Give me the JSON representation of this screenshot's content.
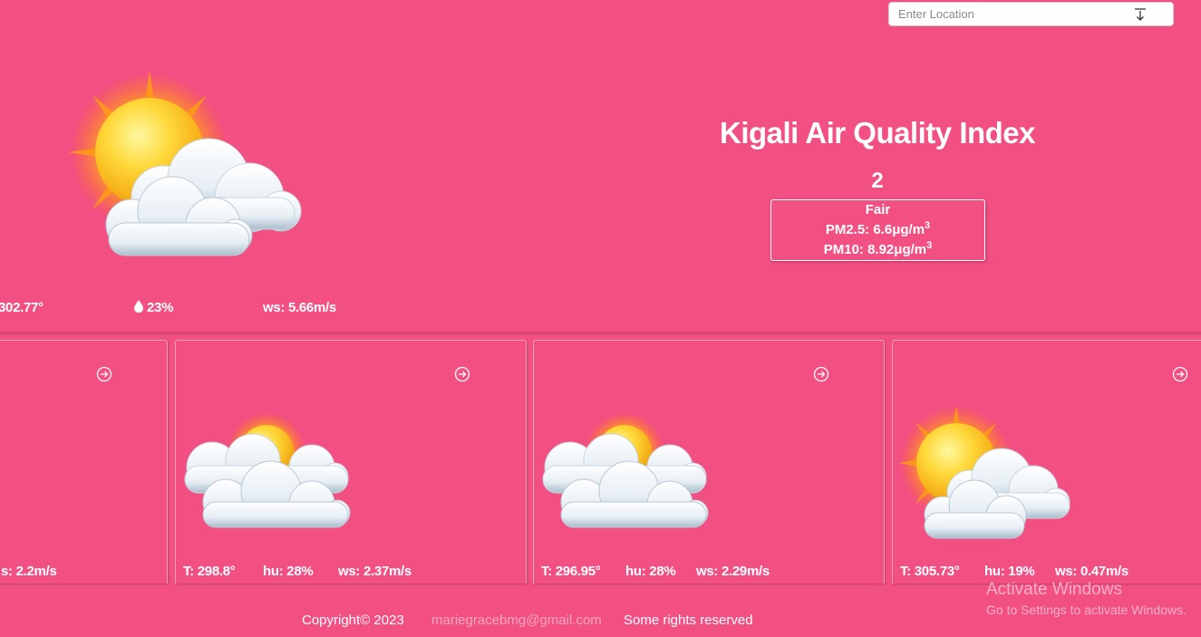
{
  "location_search": {
    "placeholder": "Enter Location",
    "button_icon": "search-arrow-icon"
  },
  "aqi": {
    "title": "Kigali Air Quality Index",
    "value": "2",
    "label": "Fair",
    "pm25_label": "PM2.5: 6.6μg/m",
    "pm10_label": "PM10: 8.92μg/m",
    "unit_exponent": "3"
  },
  "current": {
    "temp": "302.77°",
    "humidity_icon": "droplet-icon",
    "humidity": "23%",
    "wind": "ws: 5.66m/s"
  },
  "forecast": [
    {
      "temp": "",
      "humidity": "",
      "wind": "s: 2.2m/s"
    },
    {
      "temp": "T: 298.8°",
      "humidity": "hu: 28%",
      "wind": "ws: 2.37m/s"
    },
    {
      "temp": "T: 296.95°",
      "humidity": "hu: 28%",
      "wind": "ws: 2.29m/s"
    },
    {
      "temp": "T: 305.73°",
      "humidity": "hu: 19%",
      "wind": "ws: 0.47m/s"
    }
  ],
  "footer": {
    "copyright": "Copyright© 2023",
    "email": "mariegracebmg@gmail.com",
    "rights": "Some rights reserved"
  },
  "watermark": {
    "line1": "Activate Windows",
    "line2": "Go to Settings to activate Windows."
  },
  "colors": {
    "background": "#f24f83",
    "email": "#f9a7bf"
  }
}
